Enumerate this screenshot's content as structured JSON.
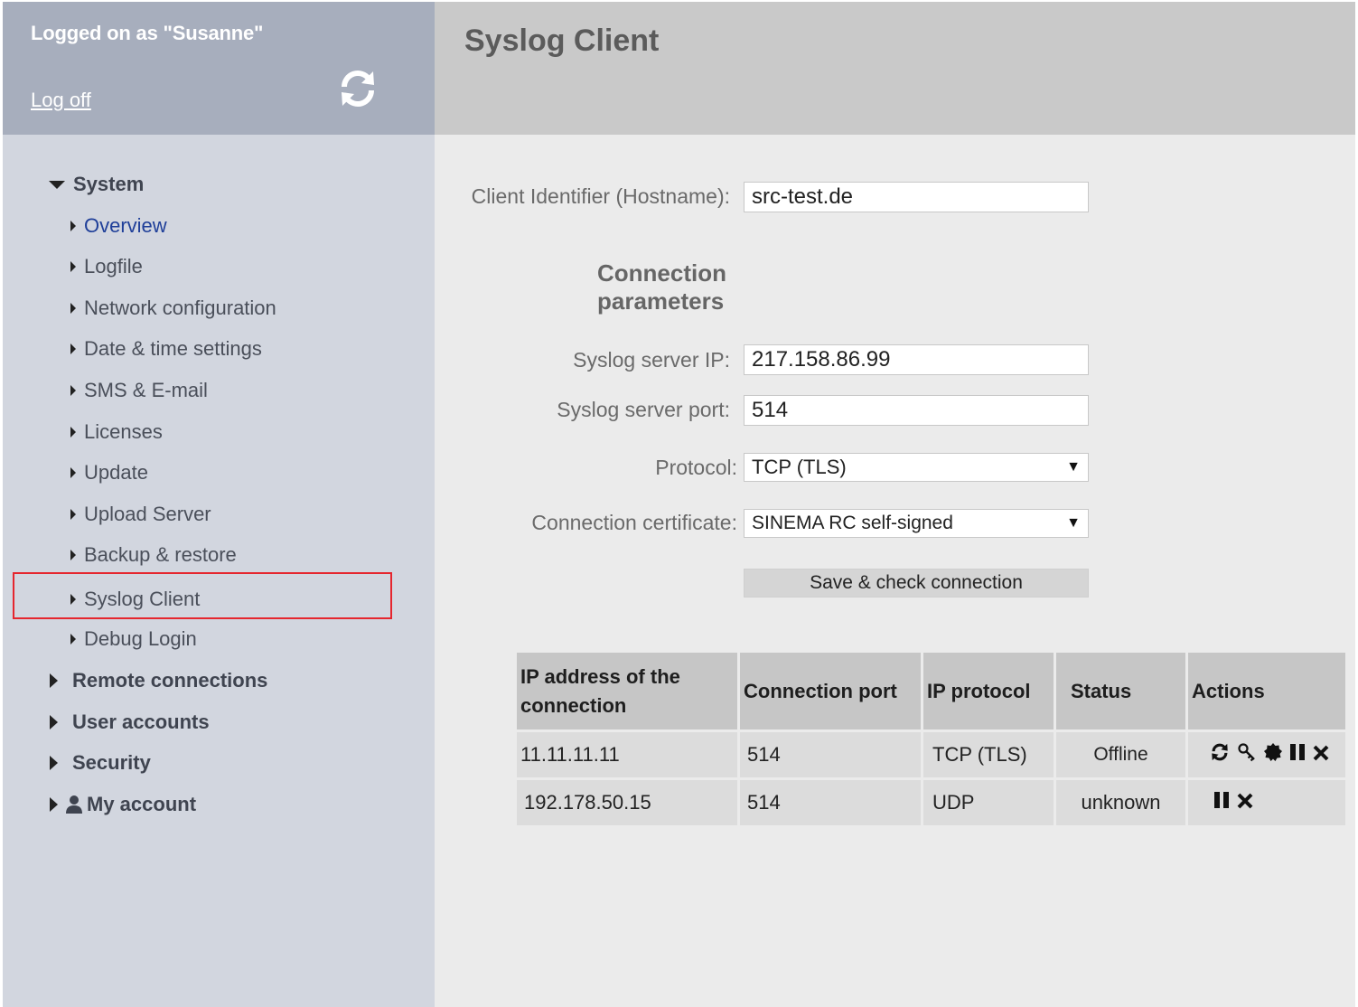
{
  "session": {
    "logged_on": "Logged on as \"Susanne\"",
    "logoff_label": "Log off",
    "refresh_icon": "refresh-icon"
  },
  "nav": {
    "system": {
      "label": "System",
      "expanded": true
    },
    "system_items": [
      {
        "label": "Overview"
      },
      {
        "label": "Logfile"
      },
      {
        "label": "Network configuration"
      },
      {
        "label": "Date & time settings"
      },
      {
        "label": "SMS & E-mail"
      },
      {
        "label": "Licenses"
      },
      {
        "label": "Update"
      },
      {
        "label": "Upload Server"
      },
      {
        "label": "Backup & restore"
      },
      {
        "label": "Syslog Client"
      },
      {
        "label": "Debug Login"
      }
    ],
    "top_items": [
      {
        "label": "Remote connections"
      },
      {
        "label": "User accounts"
      },
      {
        "label": "Security"
      },
      {
        "label": "My account",
        "icon": "user-icon"
      }
    ],
    "active": "Syslog Client",
    "highlight_color": "#e5262e"
  },
  "page": {
    "title": "Syslog Client"
  },
  "form": {
    "client_id_label": "Client Identifier (Hostname):",
    "client_id_value": "src-test.de",
    "section_title_line1": "Connection",
    "section_title_line2": "parameters",
    "server_ip_label": "Syslog server IP:",
    "server_ip_value": "217.158.86.99",
    "server_port_label": "Syslog server port:",
    "server_port_value": "514",
    "protocol_label": "Protocol:",
    "protocol_value": "TCP (TLS)",
    "certificate_label": "Connection certificate:",
    "certificate_value": "SINEMA RC self-signed",
    "save_button": "Save & check connection"
  },
  "table": {
    "headers": {
      "ip_line1": "IP address of the",
      "ip_line2": "connection",
      "port": "Connection port",
      "protocol": "IP protocol",
      "status": "Status",
      "actions": "Actions"
    },
    "rows": [
      {
        "ip": "11.11.11.11",
        "port": "514",
        "protocol": "TCP (TLS)",
        "status": "Offline",
        "actions": [
          "refresh-icon",
          "key-icon",
          "certificate-icon",
          "pause-icon",
          "delete-icon"
        ]
      },
      {
        "ip": "192.178.50.15",
        "port": "514",
        "protocol": "UDP",
        "status": "unknown",
        "actions": [
          "pause-icon",
          "delete-icon"
        ]
      }
    ]
  }
}
